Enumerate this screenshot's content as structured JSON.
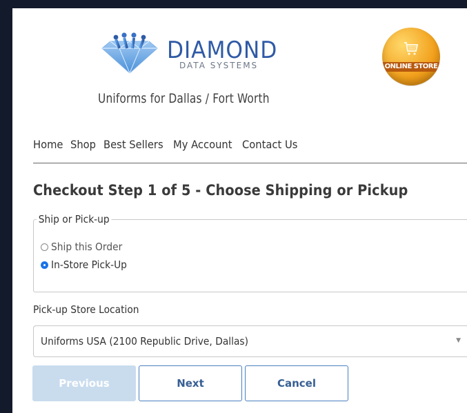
{
  "brand": {
    "name": "DIAMOND",
    "subtitle": "DATA SYSTEMS",
    "tagline": "Uniforms for Dallas / Fort Worth",
    "badge_label": "ONLINE STORE",
    "accent_color": "#2f5aa6",
    "badge_color": "#f2a11d"
  },
  "nav": {
    "items": [
      {
        "label": "Home"
      },
      {
        "label": "Shop"
      },
      {
        "label": "Best Sellers"
      },
      {
        "label": "My Account"
      },
      {
        "label": "Contact Us"
      }
    ]
  },
  "checkout": {
    "title": "Checkout Step 1 of 5 - Choose Shipping or Pickup",
    "ship_or_pickup": {
      "legend": "Ship or Pick-up",
      "options": [
        {
          "label": "Ship this Order",
          "checked": false
        },
        {
          "label": "In-Store Pick-Up",
          "checked": true
        }
      ]
    },
    "pickup_location": {
      "label": "Pick-up Store Location",
      "selected": "Uniforms USA (2100 Republic Drive, Dallas)"
    },
    "buttons": {
      "previous": "Previous",
      "next": "Next",
      "cancel": "Cancel"
    }
  }
}
